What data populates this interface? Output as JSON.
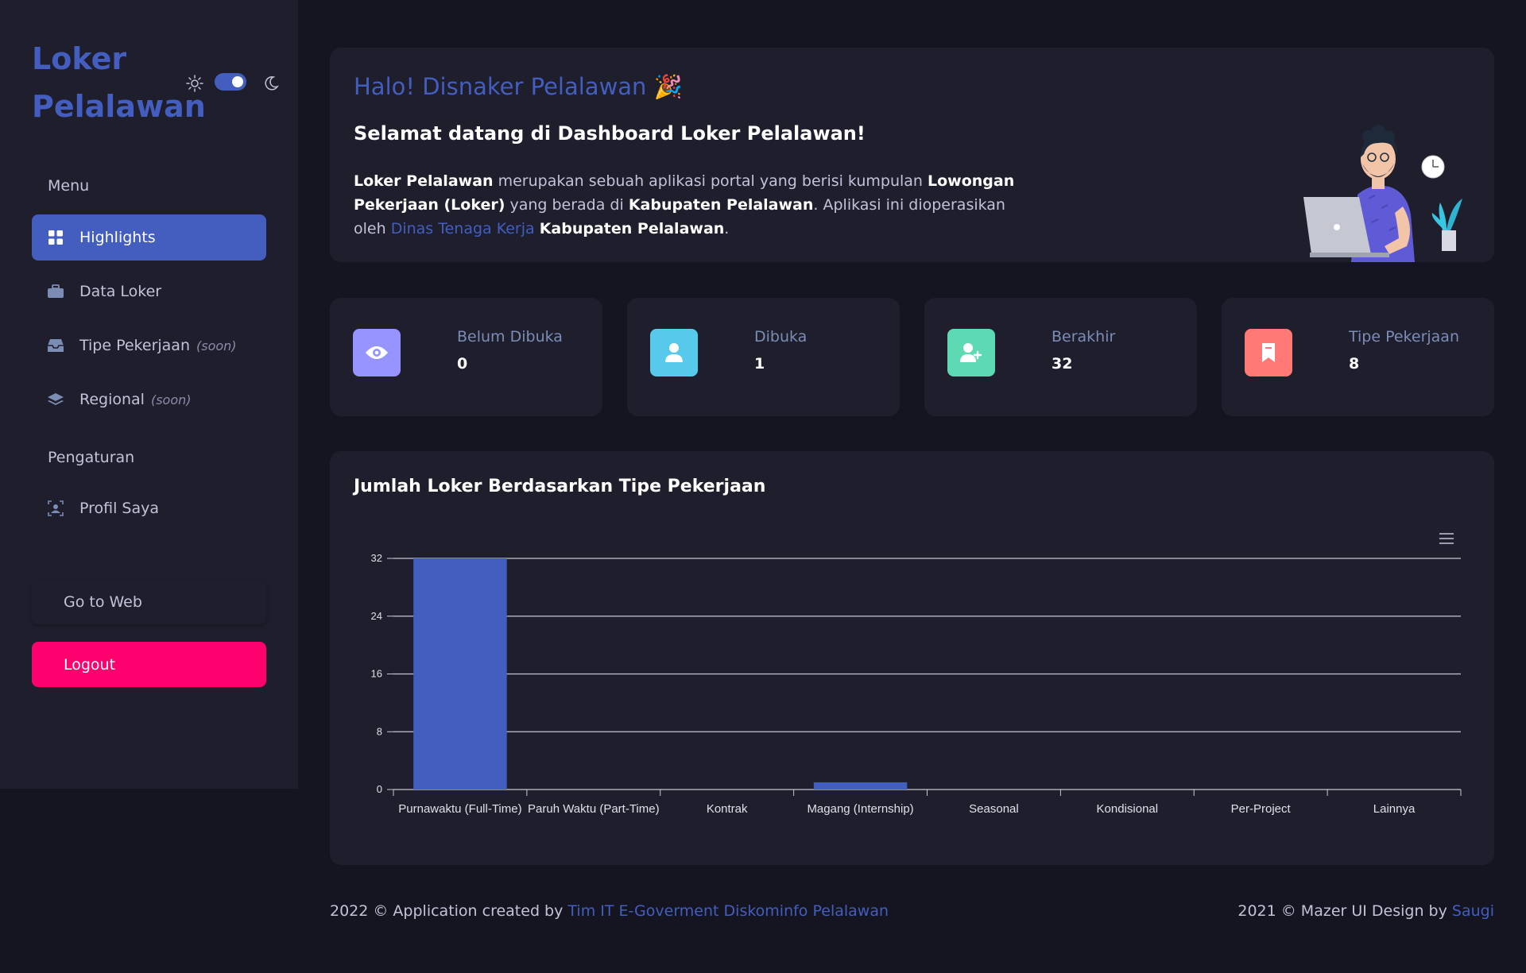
{
  "sidebar": {
    "brand_line1": "Loker",
    "brand_line2": "Pelalawan",
    "menu_title": "Menu",
    "items": [
      {
        "label": "Highlights",
        "icon": "grid-icon",
        "active": true,
        "soon": ""
      },
      {
        "label": "Data Loker",
        "icon": "briefcase-icon",
        "active": false,
        "soon": ""
      },
      {
        "label": "Tipe Pekerjaan",
        "icon": "inbox-icon",
        "active": false,
        "soon": "(soon)"
      },
      {
        "label": "Regional",
        "icon": "layers-icon",
        "active": false,
        "soon": "(soon)"
      }
    ],
    "settings_title": "Pengaturan",
    "settings_items": [
      {
        "label": "Profil Saya",
        "icon": "person-badge-icon"
      }
    ],
    "go_web_label": "Go to Web",
    "logout_label": "Logout"
  },
  "welcome": {
    "greeting": "Halo! Disnaker Pelalawan 🎉",
    "title": "Selamat datang di Dashboard Loker Pelalawan!",
    "desc_b1": "Loker Pelalawan",
    "desc_t1": " merupakan sebuah aplikasi portal yang berisi kumpulan ",
    "desc_b2": "Lowongan Pekerjaan (Loker)",
    "desc_t2": " yang berada di ",
    "desc_b3": "Kabupaten Pelalawan",
    "desc_t3": ". Aplikasi ini dioperasikan oleh ",
    "desc_link": "Dinas Tenaga Kerja",
    "desc_t4": " ",
    "desc_b4": "Kabupaten Pelalawan",
    "desc_t5": "."
  },
  "stats": [
    {
      "label": "Belum Dibuka",
      "value": "0",
      "icon": "eye-icon",
      "color": "#9694ff"
    },
    {
      "label": "Dibuka",
      "value": "1",
      "icon": "person-icon",
      "color": "#57caeb"
    },
    {
      "label": "Berakhir",
      "value": "32",
      "icon": "person-add-icon",
      "color": "#5ddab4"
    },
    {
      "label": "Tipe Pekerjaan",
      "value": "8",
      "icon": "bookmark-icon",
      "color": "#ff7976"
    }
  ],
  "chart_title": "Jumlah Loker Berdasarkan Tipe Pekerjaan",
  "chart_data": {
    "type": "bar",
    "title": "Jumlah Loker Berdasarkan Tipe Pekerjaan",
    "categories": [
      "Purnawaktu (Full-Time)",
      "Paruh Waktu (Part-Time)",
      "Kontrak",
      "Magang (Internship)",
      "Seasonal",
      "Kondisional",
      "Per-Project",
      "Lainnya"
    ],
    "values": [
      32,
      0,
      0,
      1,
      0,
      0,
      0,
      0
    ],
    "yticks": [
      "0",
      "8",
      "16",
      "24",
      "32"
    ],
    "ylim": [
      0,
      32
    ],
    "color": "#435ebe",
    "grid": true
  },
  "footer": {
    "left_text": "2022 © Application created by ",
    "left_link": "Tim IT E-Goverment Diskominfo Pelalawan",
    "right_text": "2021 © Mazer UI Design by ",
    "right_link": "Saugi"
  }
}
